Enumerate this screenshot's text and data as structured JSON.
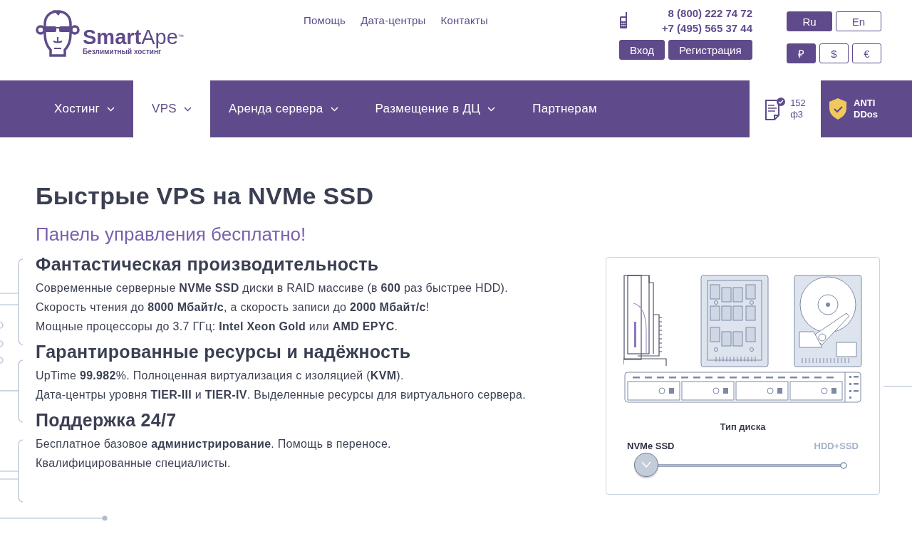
{
  "logo": {
    "name_bold": "Smart",
    "name_light": "Ape",
    "trademark": "™",
    "tagline": "Безлимитный хостинг"
  },
  "top_links": [
    "Помощь",
    "Дата-центры",
    "Контакты"
  ],
  "phones": [
    "8 (800) 222 74 72",
    "+7 (495) 565 37 44"
  ],
  "account_buttons": [
    "Вход",
    "Регистрация"
  ],
  "languages": [
    {
      "label": "Ru",
      "selected": true
    },
    {
      "label": "En",
      "selected": false
    }
  ],
  "currencies": [
    {
      "label": "₽",
      "selected": true
    },
    {
      "label": "$",
      "selected": false
    },
    {
      "label": "€",
      "selected": false
    }
  ],
  "nav": [
    {
      "label": "Хостинг",
      "dropdown": true,
      "selected": false
    },
    {
      "label": "VPS",
      "dropdown": true,
      "selected": true
    },
    {
      "label": "Аренда сервера",
      "dropdown": true,
      "selected": false
    },
    {
      "label": "Размещение в ДЦ",
      "dropdown": true,
      "selected": false
    },
    {
      "label": "Партнерам",
      "dropdown": false,
      "selected": false
    }
  ],
  "law_badge": [
    "152",
    "ф3"
  ],
  "ddos_badge": [
    "ANTI",
    "DDos"
  ],
  "hero": {
    "title": "Быстрые VPS на NVMe SSD",
    "subtitle": "Панель управления бесплатно!"
  },
  "features": [
    {
      "title": "Фантастическая производительность",
      "lines": [
        "Современные серверные **NVMe SSD** диски в RAID массиве (в **600** раз быстрее HDD).",
        "Скорость чтения до **8000 Мбайт/с**, а скорость записи до **2000 Мбайт/с**!",
        "Мощные процессоры до 3.7 ГГц: **Intel Xeon Gold** или **AMD EPYC**."
      ]
    },
    {
      "title": "Гарантированные ресурсы и надёжность",
      "lines": [
        "UpTime **99.982**%. Полноценная виртуализация с изоляцией (**KVM**).",
        "Дата-центры уровня **TIER-III** и **TIER-IV**. Выделенные ресурсы для виртуального сервера."
      ]
    },
    {
      "title": "Поддержка 24/7",
      "lines": [
        "Бесплатное базовое **администрирование**. Помощь в переносе.",
        "Квалифицированные специалисты."
      ]
    }
  ],
  "disk_panel": {
    "title": "Тип диска",
    "options": [
      {
        "label": "NVMe SSD",
        "selected": true
      },
      {
        "label": "HDD+SSD",
        "selected": false
      }
    ],
    "level": 0
  }
}
